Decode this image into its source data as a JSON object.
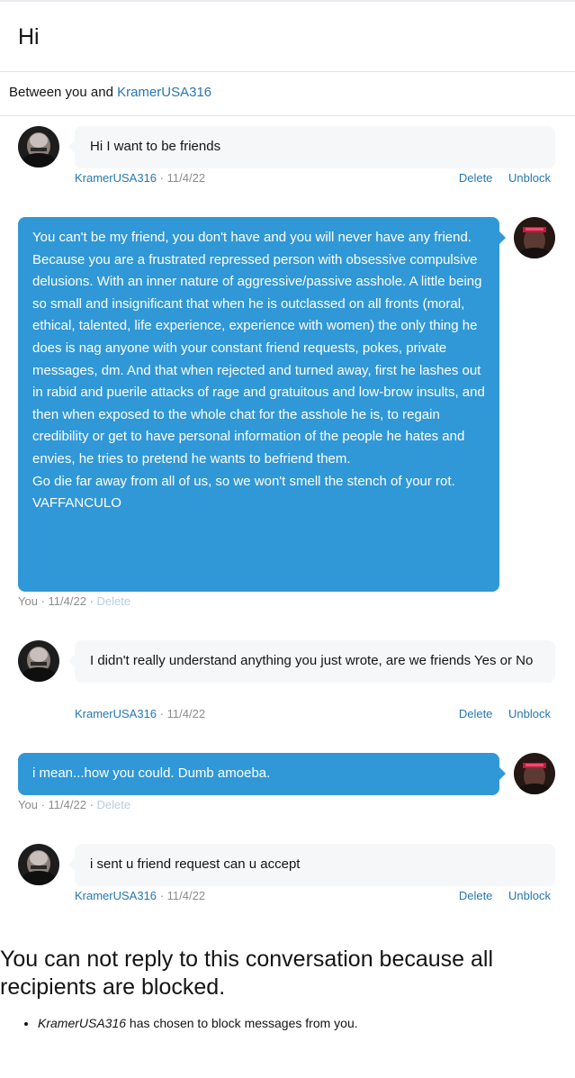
{
  "conversation": {
    "title": "Hi",
    "participants_prefix": "Between you and",
    "participant_name": "KramerUSA316"
  },
  "labels": {
    "delete": "Delete",
    "unblock": "Unblock",
    "separator": "·"
  },
  "messages": [
    {
      "from": "other",
      "author": "KramerUSA316",
      "date": "11/4/22",
      "text": "Hi I want to be friends"
    },
    {
      "from": "self",
      "author": "You",
      "date": "11/4/22",
      "text": "You can't be my friend, you don't have and you will never have any friend.\nBecause you are a frustrated repressed person with obsessive compulsive delusions. With an inner nature of aggressive/passive asshole. A little being so small and insignificant that when he is outclassed on all fronts (moral, ethical, talented, life experience, experience with women) the only thing he does is nag anyone with your constant friend requests, pokes, private messages, dm. And that when rejected and turned away, first he lashes out in rabid and puerile attacks of rage and gratuitous and low-brow insults, and then when exposed to the whole chat for the asshole he is, to regain credibility or get to have personal information of the people he hates and envies, he tries to pretend he wants to befriend them.\nGo die far away from all of us, so we won't smell the stench of your rot.\nVAFFANCULO"
    },
    {
      "from": "other",
      "author": "KramerUSA316",
      "date": "11/4/22",
      "text": "I didn't really understand anything you just wrote, are we friends Yes or No"
    },
    {
      "from": "self",
      "author": "You",
      "date": "11/4/22",
      "text": "i mean...how you could. Dumb amoeba."
    },
    {
      "from": "other",
      "author": "KramerUSA316",
      "date": "11/4/22",
      "text": "i sent u friend request can u accept"
    }
  ],
  "blocked_notice": {
    "heading": "You can not reply to this conversation because all recipients are blocked.",
    "item_user": "KramerUSA316",
    "item_text": " has chosen to block messages from you."
  },
  "colors": {
    "accent_link": "#2577b1",
    "my_bubble": "#3098d6",
    "other_bubble": "#f5f7f9"
  },
  "icons": {
    "other_avatar": "bald-man-photo-avatar",
    "my_avatar": "dark-hooded-figure-avatar"
  }
}
